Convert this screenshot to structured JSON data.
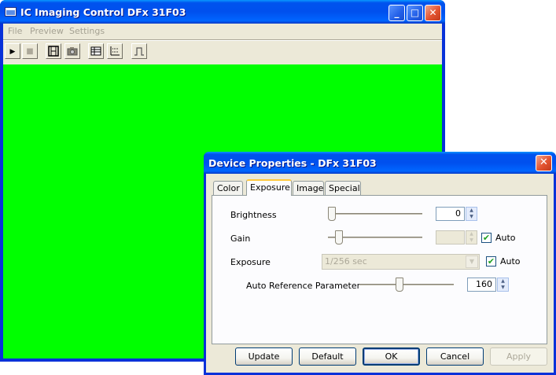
{
  "main_window": {
    "title": "IC Imaging Control DFx 31F03",
    "caption_buttons": {
      "minimize": "_",
      "maximize": "□",
      "close": "✕"
    },
    "menu": [
      "File",
      "Preview",
      "Settings"
    ],
    "toolbar": {
      "play": "▶",
      "stop": "■",
      "capture_video": "film-icon",
      "snap_image": "camera-icon",
      "properties": "grid-icon",
      "histogram": "histogram-icon",
      "trigger": "pulse-icon"
    },
    "preview_color": "#00ff00"
  },
  "dialog": {
    "title": "Device Properties - DFx 31F03",
    "close_glyph": "✕",
    "tabs": [
      "Color",
      "Exposure",
      "Image",
      "Special"
    ],
    "active_tab": "Exposure",
    "brightness": {
      "label": "Brightness",
      "value": "0",
      "slider_position": 0.0
    },
    "gain": {
      "label": "Gain",
      "value": "",
      "auto_label": "Auto",
      "auto_checked": true,
      "slider_position": 0.08
    },
    "exposure": {
      "label": "Exposure",
      "value": "1/256 sec",
      "auto_label": "Auto",
      "auto_checked": true
    },
    "auto_reference": {
      "label": "Auto Reference Parameter",
      "value": "160",
      "slider_position": 0.42
    },
    "check_glyph": "✔",
    "spin_up": "▲",
    "spin_down": "▼",
    "combo_arrow": "▼",
    "buttons": {
      "update": "Update",
      "default": "Default",
      "ok": "OK",
      "cancel": "Cancel",
      "apply": "Apply"
    }
  }
}
